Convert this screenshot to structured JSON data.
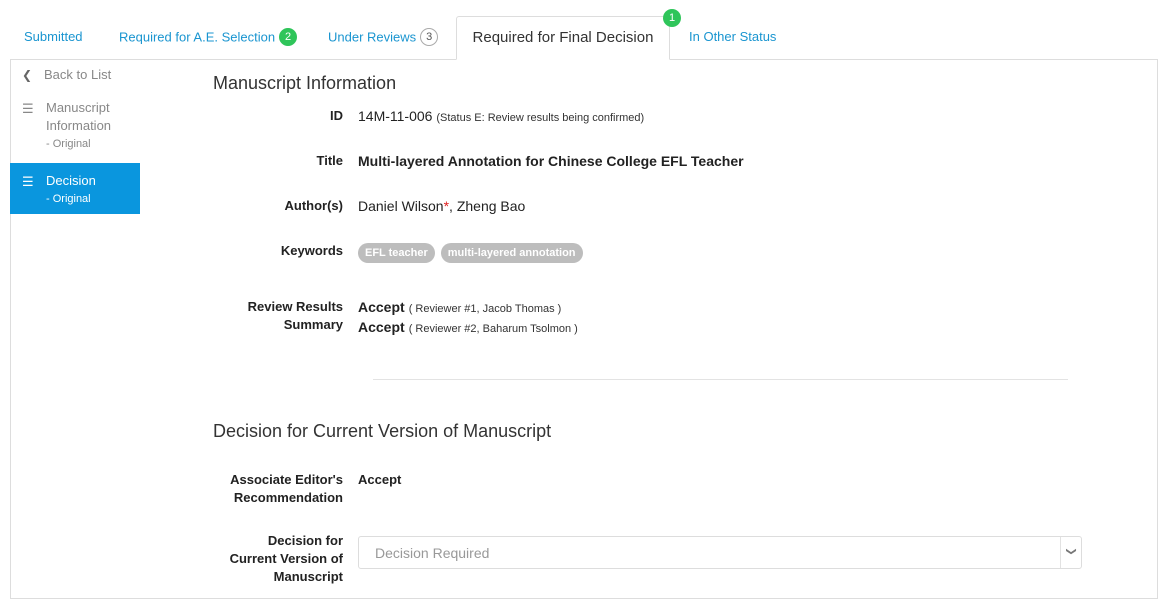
{
  "tabs": [
    {
      "label": "Submitted"
    },
    {
      "label": "Required for A.E. Selection",
      "badge": "2"
    },
    {
      "label": "Under Reviews",
      "badge": "3"
    },
    {
      "label": "Required for Final Decision",
      "badge": "1"
    },
    {
      "label": "In Other Status"
    }
  ],
  "sidebar": {
    "back_label": "Back to List",
    "items": [
      {
        "label": "Manuscript Information",
        "sub": "- Original"
      },
      {
        "label": "Decision",
        "sub": "- Original"
      }
    ]
  },
  "manuscript": {
    "section_title": "Manuscript Information",
    "id_label": "ID",
    "id_value": "14M-11-006",
    "id_status": "(Status E: Review results being confirmed)",
    "title_label": "Title",
    "title_value": "Multi-layered Annotation for Chinese College EFL Teacher",
    "authors_label": "Author(s)",
    "author_1": "Daniel Wilson",
    "author_1_mark": "*",
    "author_sep": ", ",
    "author_2": "Zheng Bao",
    "keywords_label": "Keywords",
    "keywords": [
      "EFL teacher",
      "multi-layered annotation"
    ],
    "review_label_1": "Review Results",
    "review_label_2": "Summary",
    "reviews": [
      {
        "result": "Accept",
        "detail": "( Reviewer #1, Jacob Thomas )"
      },
      {
        "result": "Accept",
        "detail": "( Reviewer #2, Baharum Tsolmon )"
      }
    ]
  },
  "decision": {
    "section_title": "Decision for Current Version of Manuscript",
    "ae_label_1": "Associate Editor's",
    "ae_label_2": "Recommendation",
    "ae_value": "Accept",
    "decision_label_1": "Decision for",
    "decision_label_2": "Current Version of",
    "decision_label_3": "Manuscript",
    "select_placeholder": "Decision Required"
  },
  "colors": {
    "link": "#1a95d0",
    "active": "#0a96de",
    "badge_green": "#2fc55a",
    "required_star": "#e02020"
  }
}
